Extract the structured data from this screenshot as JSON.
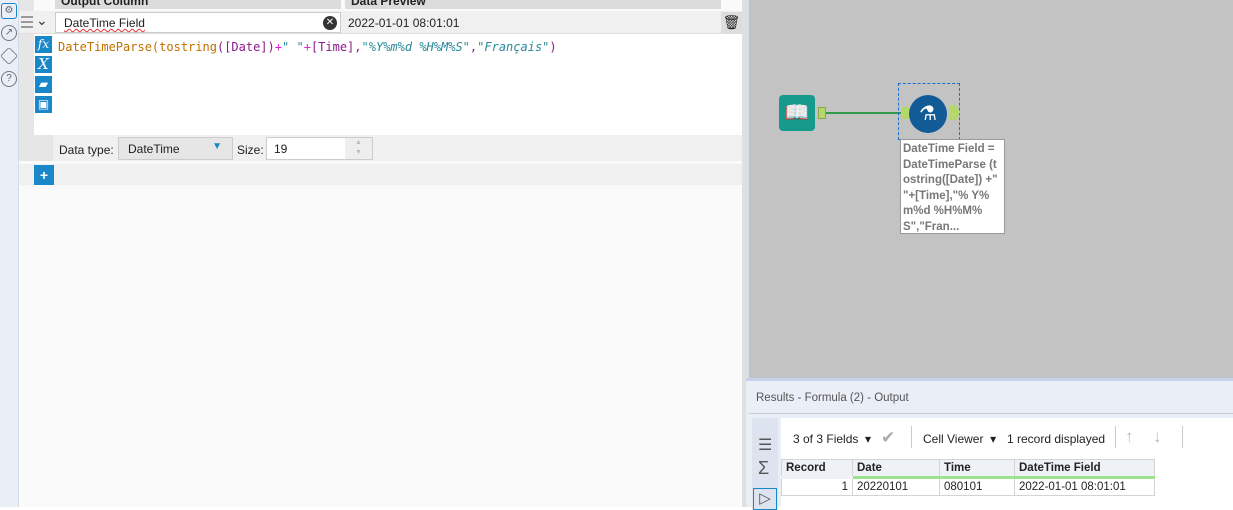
{
  "editor": {
    "col_header": "Output Column",
    "preview_header": "Data Preview",
    "output_name": "DateTime Field",
    "preview_value": "2022-01-01 08:01:01",
    "formula": {
      "fn": "DateTimeParse",
      "p1": "(",
      "fn2": "tostring",
      "p2": "(",
      "f1": "[Date]",
      "p3": ")",
      "plus1": "+",
      "s1": "\" \"",
      "plus2": "+",
      "f2": "[Time]",
      "c1": ",",
      "s2": "\"%Y%m%d %H%M%S\"",
      "c2": ",",
      "s3": "\"Français\"",
      "p4": ")"
    },
    "data_type_label": "Data type:",
    "data_type": "DateTime",
    "size_label": "Size:",
    "size": "19"
  },
  "canvas": {
    "annotation": "DateTime Field = DateTimeParse (tostring([Date]) +\" \"+[Time],\"% Y%m%d %H%M% S\",\"Fran..."
  },
  "results": {
    "title": "Results - Formula (2) - Output",
    "fields": "3 of 3 Fields",
    "viewer": "Cell Viewer",
    "records": "1 record displayed",
    "columns": [
      "Record",
      "Date",
      "Time",
      "DateTime Field"
    ],
    "rows": [
      [
        "1",
        "20220101",
        "080101",
        "2022-01-01 08:01:01"
      ]
    ]
  }
}
